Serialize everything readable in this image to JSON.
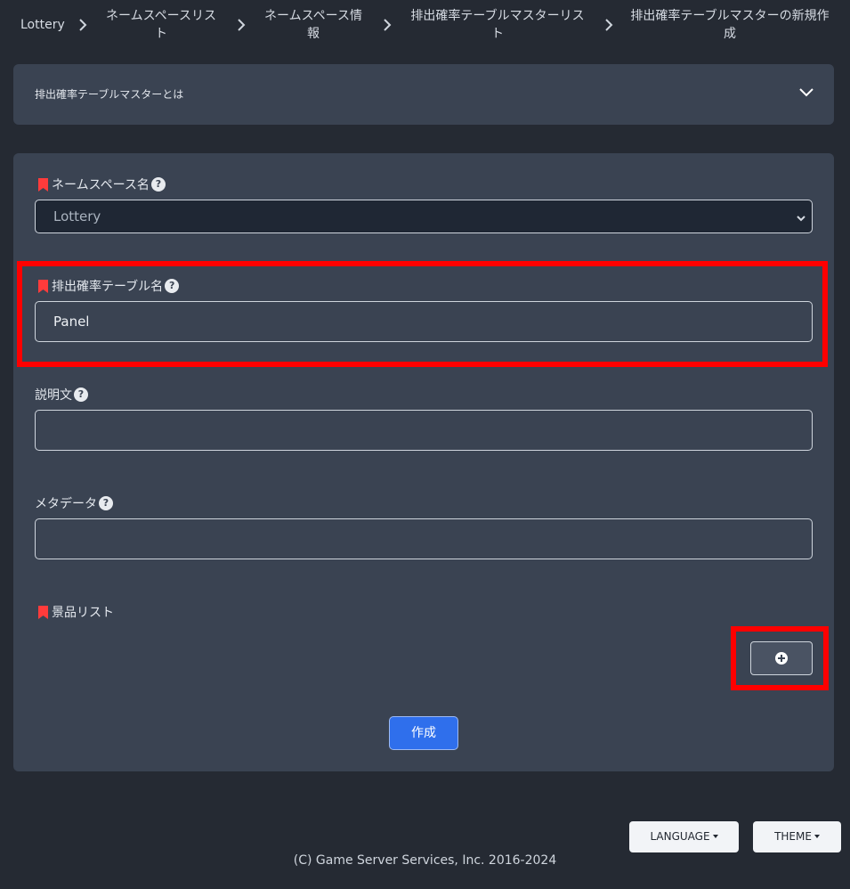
{
  "breadcrumb": {
    "root": "Lottery",
    "items": [
      {
        "line1": "ネームスペースリス",
        "line2": "ト"
      },
      {
        "line1": "ネームスペース情",
        "line2": "報"
      },
      {
        "line1": "排出確率テーブルマスターリス",
        "line2": "ト"
      },
      {
        "line1": "排出確率テーブルマスターの新規作",
        "line2": "成"
      }
    ]
  },
  "about": {
    "title": "排出確率テーブルマスターとは"
  },
  "form": {
    "namespace_label": "ネームスペース名",
    "namespace_value": "Lottery",
    "table_name_label": "排出確率テーブル名",
    "table_name_value": "Panel",
    "description_label": "説明文",
    "description_value": "",
    "metadata_label": "メタデータ",
    "metadata_value": "",
    "prizes_label": "景品リスト",
    "create_label": "作成"
  },
  "footer": {
    "language_label": "LANGUAGE",
    "theme_label": "THEME",
    "copyright": "(C) Game Server Services, Inc. 2016-2024"
  },
  "colors": {
    "background": "#252a33",
    "panel": "#3a4352",
    "accent": "#2f6fec",
    "required": "#ff3b3b",
    "highlight": "#ff0000"
  }
}
